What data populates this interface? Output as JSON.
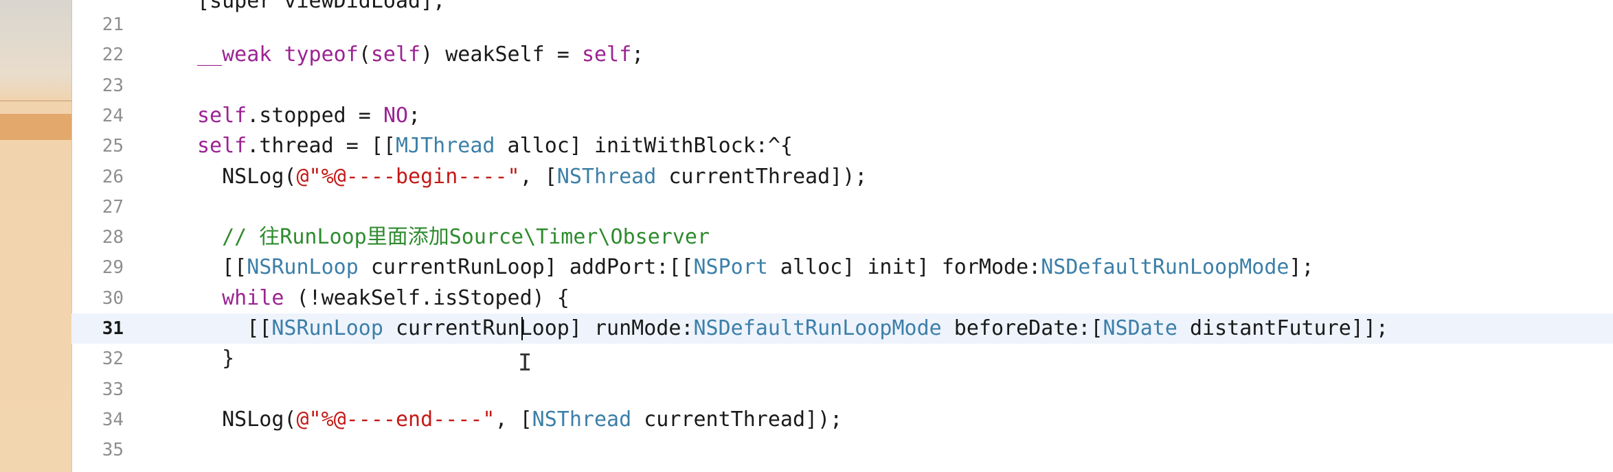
{
  "editor": {
    "partial_top_line": "[super viewDidLoad];",
    "lines": [
      {
        "num": "21",
        "text": ""
      },
      {
        "num": "22",
        "parts": [
          [
            "kw",
            "__weak"
          ],
          [
            "",
            "  "
          ],
          [
            "kw",
            "typeof"
          ],
          [
            "",
            "("
          ],
          [
            "kw",
            "self"
          ],
          [
            "",
            ") weakSelf = "
          ],
          [
            "kw",
            "self"
          ],
          [
            "",
            ";"
          ]
        ]
      },
      {
        "num": "23",
        "text": ""
      },
      {
        "num": "24",
        "parts": [
          [
            "kw",
            "self"
          ],
          [
            "",
            ".stopped = "
          ],
          [
            "kw",
            "NO"
          ],
          [
            "",
            ";"
          ]
        ]
      },
      {
        "num": "25",
        "parts": [
          [
            "kw",
            "self"
          ],
          [
            "",
            ".thread = [["
          ],
          [
            "cls",
            "MJThread"
          ],
          [
            "",
            "  alloc] initWithBlock:^{"
          ]
        ]
      },
      {
        "num": "26",
        "parts": [
          [
            "",
            "    NSLog("
          ],
          [
            "str",
            "@\"%@----begin----\""
          ],
          [
            "",
            ", ["
          ],
          [
            "cls",
            "NSThread"
          ],
          [
            "",
            "  currentThread]);"
          ]
        ]
      },
      {
        "num": "27",
        "text": ""
      },
      {
        "num": "28",
        "parts": [
          [
            "cmt",
            "    // 往RunLoop里面添加Source\\Timer\\Observer"
          ]
        ]
      },
      {
        "num": "29",
        "parts": [
          [
            "",
            "    [["
          ],
          [
            "cls",
            "NSRunLoop"
          ],
          [
            "",
            "  currentRunLoop] addPort:[["
          ],
          [
            "cls",
            "NSPort"
          ],
          [
            "",
            "  alloc] init] forMode:"
          ],
          [
            "cls",
            "NSDefaultRunLoopMode"
          ],
          [
            "",
            "];"
          ]
        ]
      },
      {
        "num": "30",
        "parts": [
          [
            "kw",
            "    while"
          ],
          [
            "",
            "  (!weakSelf.isStoped) {"
          ]
        ]
      },
      {
        "num": "31",
        "parts": [
          [
            "",
            "        [["
          ],
          [
            "cls",
            "NSRunLoop"
          ],
          [
            "",
            "  currentRunLoop] runMode:"
          ],
          [
            "cls",
            "NSDefaultRunLoopMode"
          ],
          [
            "",
            "  beforeDate:["
          ],
          [
            "cls",
            "NSDate"
          ],
          [
            "",
            "  distantFuture]];"
          ]
        ],
        "current": true
      },
      {
        "num": "32",
        "parts": [
          [
            "",
            "    }"
          ]
        ]
      },
      {
        "num": "33",
        "text": ""
      },
      {
        "num": "34",
        "parts": [
          [
            "",
            "    NSLog("
          ],
          [
            "str",
            "@\"%@----end----\""
          ],
          [
            "",
            ", ["
          ],
          [
            "cls",
            "NSThread"
          ],
          [
            "",
            "  currentThread]);"
          ]
        ]
      },
      {
        "num": "35",
        "text": ""
      }
    ]
  },
  "colors": {
    "keyword": "#9b2393",
    "class": "#3c7fa8",
    "string": "#c41a16",
    "comment": "#2e8b2e",
    "current_line": "#eef3fc"
  }
}
